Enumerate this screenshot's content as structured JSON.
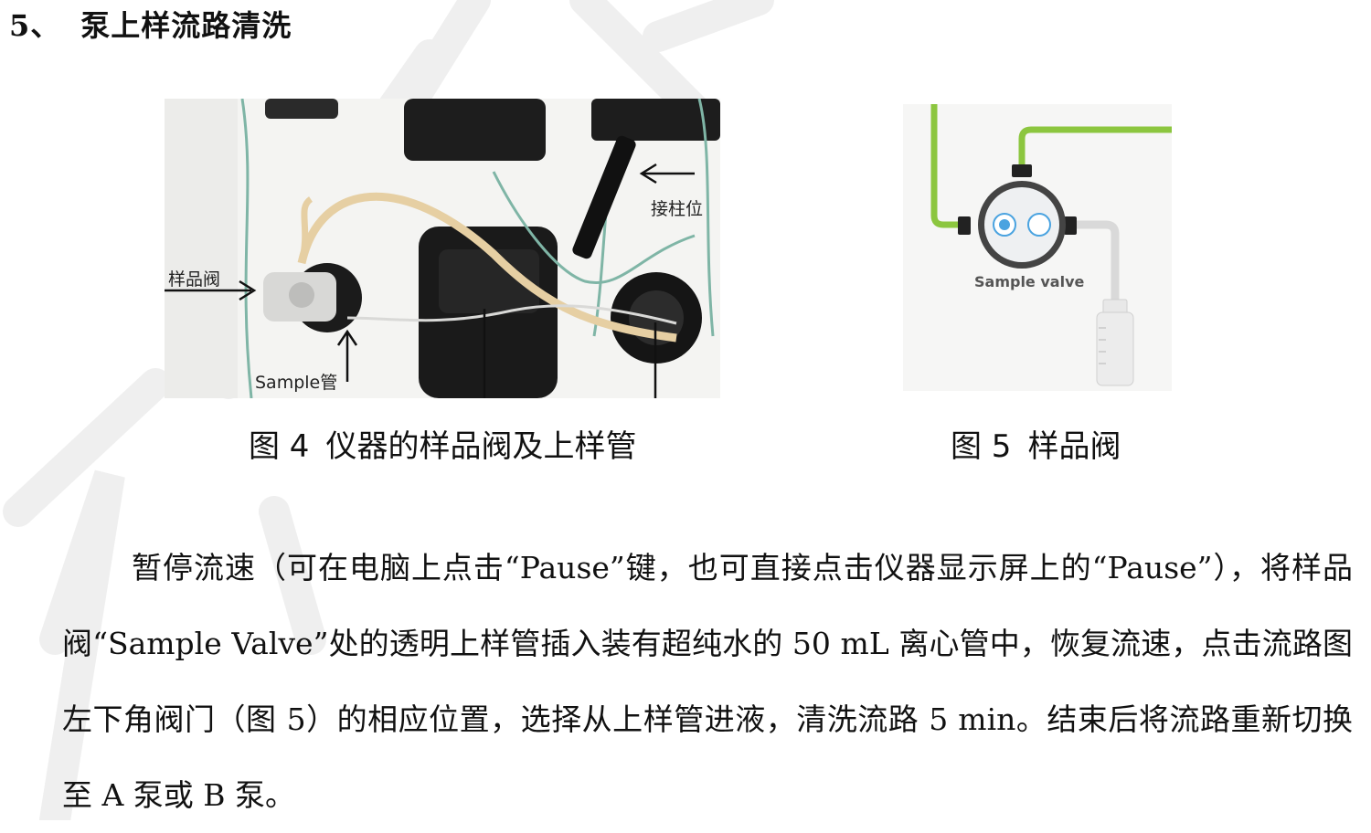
{
  "section": {
    "number": "5、",
    "title": "泵上样流路清洗"
  },
  "figure4": {
    "labels": {
      "sample_valve": "样品阀",
      "sample_tube": "Sample管",
      "column_position": "接柱位"
    },
    "caption_number": "图 4",
    "caption_text": "仪器的样品阀及上样管"
  },
  "figure5": {
    "valve_label": "Sample valve",
    "caption_number": "图 5",
    "caption_text": "样品阀"
  },
  "paragraph": "暂停流速（可在电脑上点击“Pause”键，也可直接点击仪器显示屏上的“Pause”），将样品阀“Sample Valve”处的透明上样管插入装有超纯水的 50 mL 离心管中，恢复流速，点击流路图左下角阀门（图 5）的相应位置，选择从上样管进液，清洗流路 5 min。结束后将流路重新切换至 A 泵或 B 泵。",
  "colors": {
    "tube_green": "#8cc63f",
    "watermark": "#eeeeee"
  },
  "icons": {
    "fig5_bottle": "sample-bottle-icon",
    "fig5_valve": "valve-icon"
  }
}
